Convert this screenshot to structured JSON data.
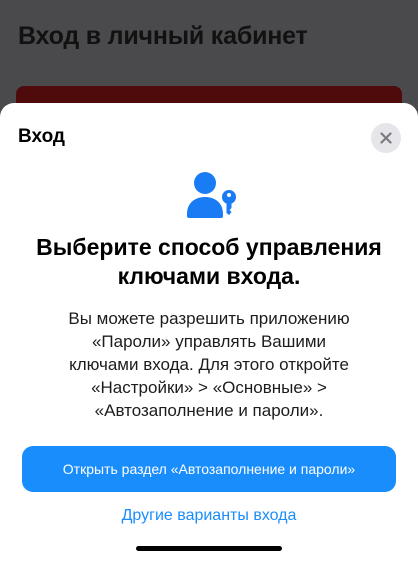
{
  "background": {
    "page_title": "Вход в личный кабинет"
  },
  "sheet": {
    "title": "Вход",
    "close_icon": "xmark-icon",
    "hero_icon": "person-key-icon",
    "heading_lines": [
      "Выберите способ управления",
      "ключами входа."
    ],
    "body_lines": [
      "Вы можете разрешить приложению",
      "«Пароли» управлять Вашими",
      "ключами входа. Для этого откройте",
      "«Настройки» > «Основные» >",
      "«Автозаполнение и пароли»."
    ],
    "primary_button_label": "Открыть раздел «Автозаполнение и пароли»",
    "secondary_link_label": "Другие варианты входа"
  },
  "colors": {
    "accent": "#1a8dfc",
    "background_dim": "#4a4a4c",
    "background_card": "#4f0b0c",
    "close_button_bg": "#e5e5ea"
  }
}
